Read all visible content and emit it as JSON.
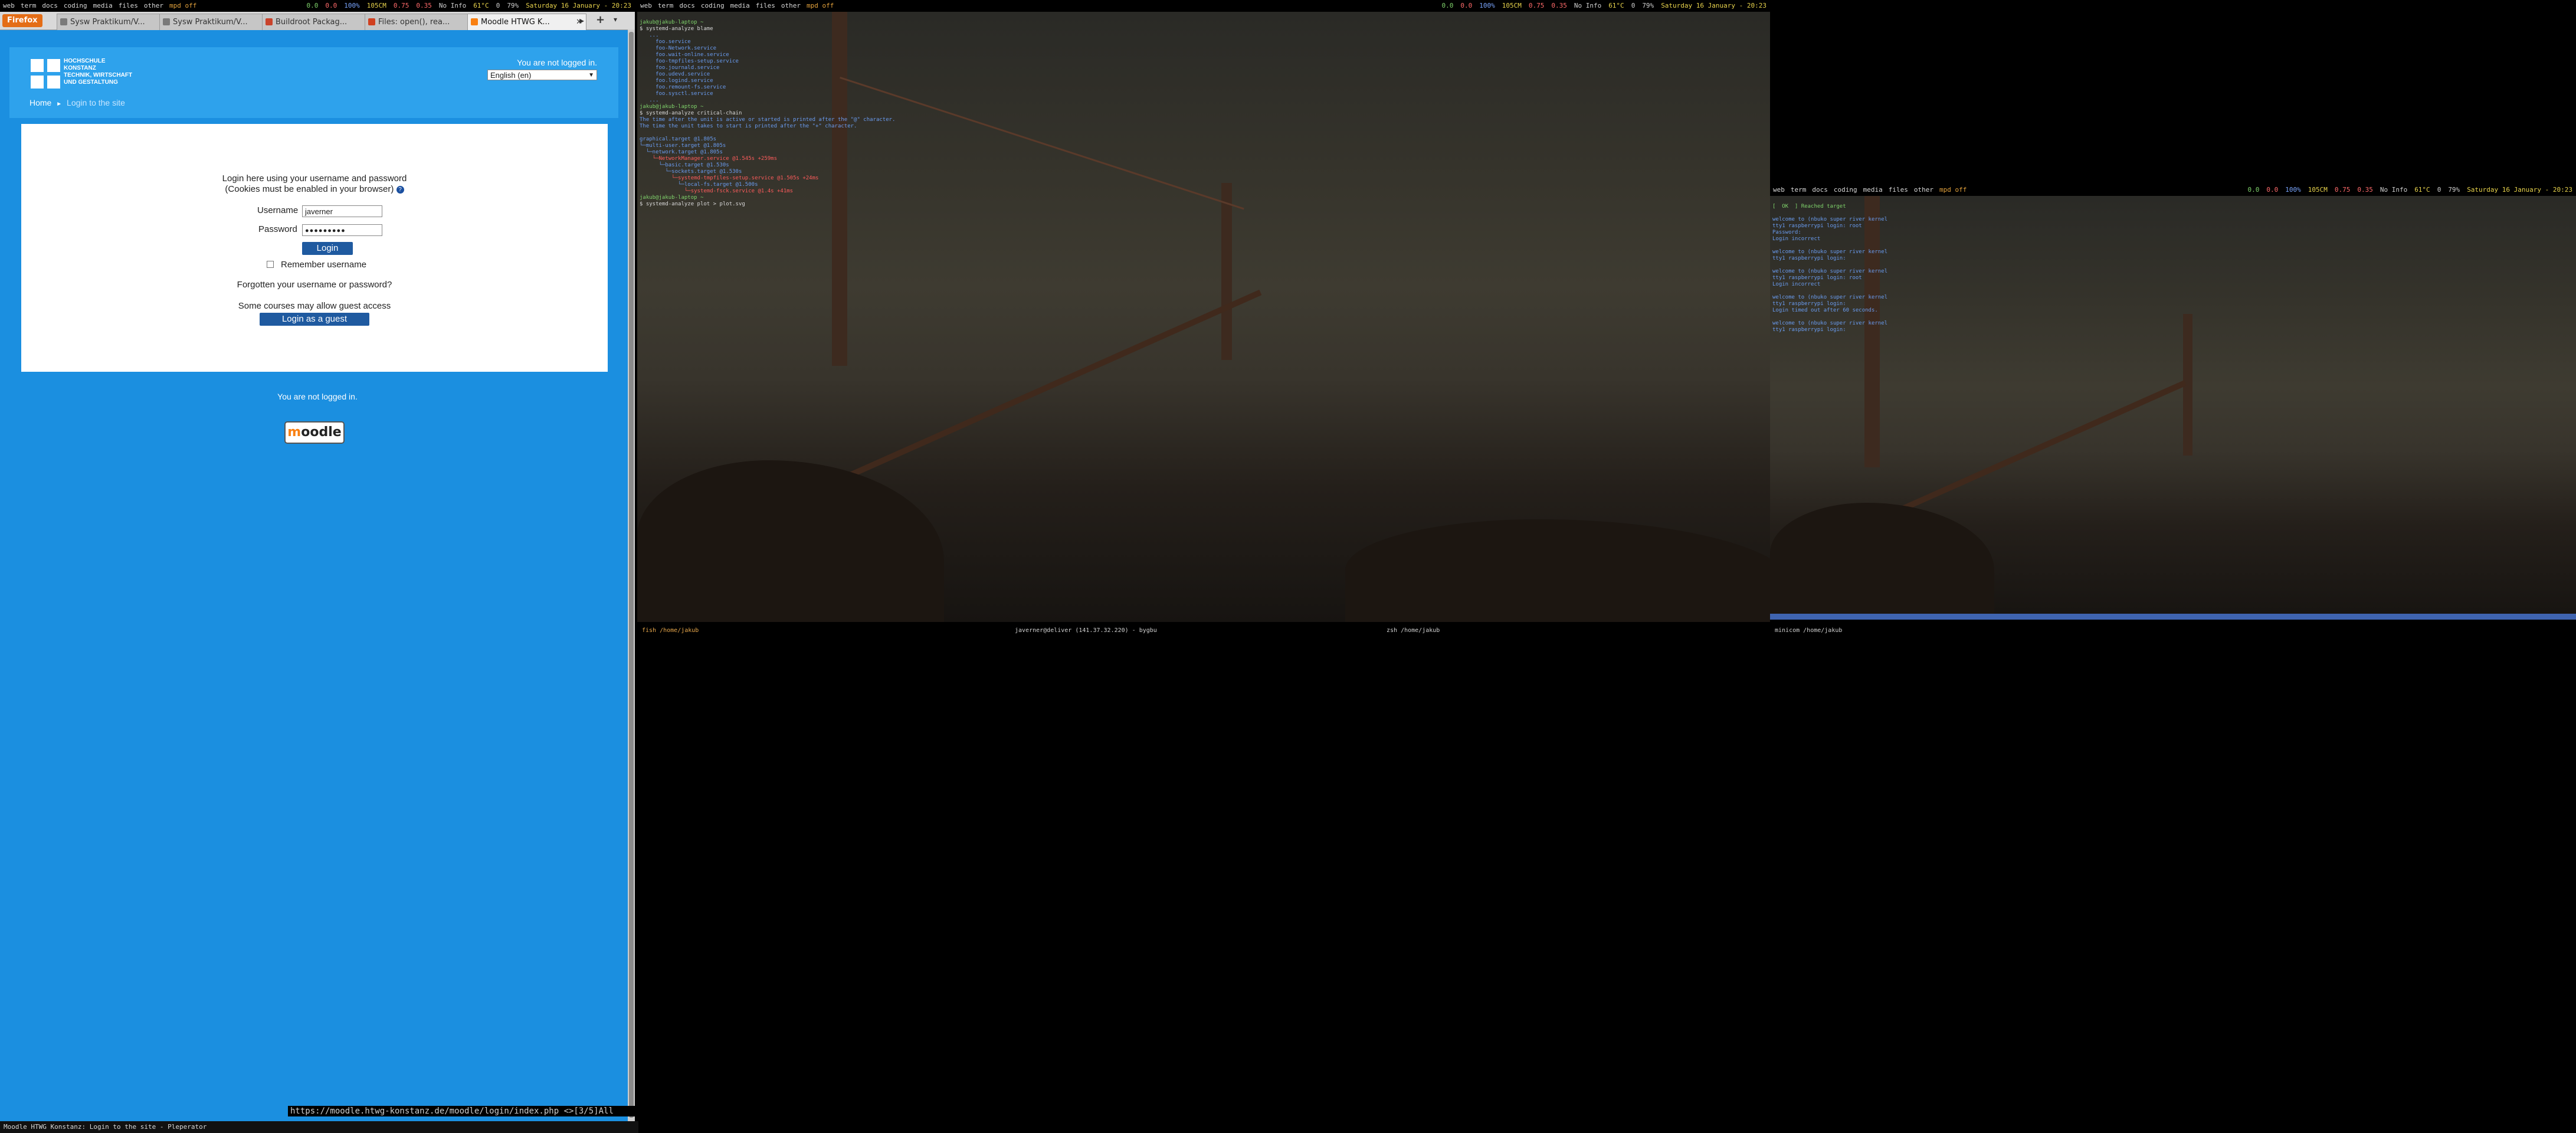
{
  "left_bar": {
    "workspaces": [
      "web",
      "term",
      "docs",
      "coding",
      "media",
      "files",
      "other"
    ],
    "mpd": "mpd off",
    "stats": [
      "0.0",
      "0.0",
      "100%",
      "105CM",
      "0.75",
      "0.35",
      "No Info",
      "61°C",
      "0",
      "79%",
      "Saturday 16 January - 20:23"
    ]
  },
  "mid_bar": {
    "workspaces": [
      "web",
      "term",
      "docs",
      "coding",
      "media",
      "files",
      "other"
    ],
    "mpd": "mpd off",
    "stats": [
      "0.0",
      "0.0",
      "100%",
      "105CM",
      "0.75",
      "0.35",
      "No Info",
      "61°C",
      "0",
      "79%",
      "Saturday 16 January - 20:23"
    ]
  },
  "right_bar": {
    "workspaces": [
      "web",
      "term",
      "docs",
      "coding",
      "media",
      "files",
      "other"
    ],
    "mpd": "mpd off",
    "stats": [
      "0.0",
      "0.0",
      "100%",
      "105CM",
      "0.75",
      "0.35",
      "No Info",
      "61°C",
      "0",
      "79%",
      "Saturday 16 January - 20:23"
    ]
  },
  "firefox": {
    "menu_button": "Firefox",
    "tabs": [
      {
        "label": "Sysw Praktikum/V..."
      },
      {
        "label": "Sysw Praktikum/V..."
      },
      {
        "label": "Buildroot Packag..."
      },
      {
        "label": "Files: open(), rea..."
      },
      {
        "label": "Moodle HTWG K..."
      }
    ],
    "new_tab": "+"
  },
  "moodle": {
    "logo_lines": [
      "HOCHSCHULE",
      "KONSTANZ",
      "TECHNIK, WIRTSCHAFT",
      "UND GESTALTUNG"
    ],
    "header_login": "You are not logged in.",
    "language": "English (en)",
    "breadcrumb_home": "Home",
    "breadcrumb_sep": "►",
    "breadcrumb_current": "Login to the site",
    "intro_line1": "Login here using your username and password",
    "intro_line2": "(Cookies must be enabled in your browser)",
    "username_label": "Username",
    "username_value": "javerner",
    "password_label": "Password",
    "password_value": "●●●●●●●●●",
    "login_button": "Login",
    "remember_label": "Remember username",
    "forgot_link": "Forgotten your username or password?",
    "guest_note": "Some courses may allow guest access",
    "guest_button": "Login as a guest",
    "footer_login": "You are not logged in.",
    "moodle_logo": "moodle"
  },
  "url_status": "https://moodle.htwg-konstanz.de/moodle/login/index.php <>[3/5]All",
  "window_title": "Moodle HTWG Konstanz: Login to the site - Pleperator",
  "term_main": {
    "lines": [
      "jakub@jakub-laptop ~",
      "$ systemd-analyze blame",
      "   ...",
      "     foo.service",
      "     foo-Network.service",
      "     foo.wait-online.service",
      "     foo-tmpfiles-setup.service",
      "     foo.journald.service",
      "     foo.udevd.service",
      "     foo.logind.service",
      "     foo.remount-fs.service",
      "     foo.sysctl.service",
      "   ...",
      "jakub@jakub-laptop ~",
      "$ systemd-analyze critical-chain",
      "The time after the unit is active or started is printed after the \"@\" character.",
      "The time the unit takes to start is printed after the \"+\" character.",
      "",
      "graphical.target @1.805s",
      "└─multi-user.target @1.805s",
      "  └─network.target @1.805s",
      "    └─NetworkManager.service @1.545s +259ms",
      "      └─basic.target @1.530s",
      "        └─sockets.target @1.530s",
      "          └─systemd-tmpfiles-setup.service @1.505s +24ms",
      "            └─local-fs.target @1.500s",
      "              └─systemd-fsck.service @1.4s +41ms",
      "jakub@jakub-laptop ~",
      "$ systemd-analyze plot > plot.svg"
    ],
    "bar_left": "fish  /home/jakub",
    "bar_mid": "javerner@deliver (141.37.32.220) - bygbu",
    "bar_right": "zsh  /home/jakub"
  },
  "term_right": {
    "header": "web  term  docs  coding  media  files  other",
    "lines": [
      "[  OK  ] Reached target",
      "",
      "welcome to (nbuko super river kernel",
      "tty1 raspberrypi login: root",
      "Password:",
      "Login incorrect",
      "",
      "welcome to (nbuko super river kernel",
      "tty1 raspberrypi login:",
      "",
      "welcome to (nbuko super river kernel",
      "tty1 raspberrypi login: root",
      "Login incorrect",
      "",
      "welcome to (nbuko super river kernel",
      "tty1 raspberrypi login:",
      "Login timed out after 60 seconds.",
      "",
      "welcome to (nbuko super river kernel",
      "tty1 raspberrypi login:"
    ],
    "bar_left": "minicom  /home/jakub"
  }
}
